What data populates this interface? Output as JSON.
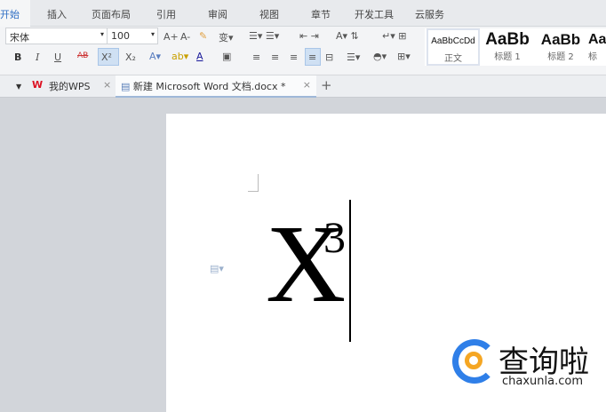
{
  "menu": {
    "tabs": [
      "开始",
      "插入",
      "页面布局",
      "引用",
      "审阅",
      "视图",
      "章节",
      "开发工具",
      "云服务"
    ]
  },
  "toolbar": {
    "font_name": "宋体",
    "font_size": "100",
    "buttons": {
      "bold": "B",
      "italic": "I",
      "underline": "U",
      "strikethrough": "AB",
      "superscript": "X²",
      "subscript": "X₂",
      "grow": "A+",
      "shrink": "A-",
      "font_color": "A"
    }
  },
  "styles": [
    {
      "preview": "AaBbCcDd",
      "name": "正文"
    },
    {
      "preview": "AaBb",
      "name": "标题 1"
    },
    {
      "preview": "AaBb",
      "name": "标题 2"
    },
    {
      "preview": "Aa",
      "name": "标"
    }
  ],
  "doctabs": {
    "wps": "我的WPS",
    "doc": "新建 Microsoft Word 文档.docx *",
    "close": "×",
    "add": "+"
  },
  "document": {
    "base": "X",
    "sup": "3"
  },
  "watermark": {
    "name": "查询啦",
    "url": "chaxunla.com"
  }
}
